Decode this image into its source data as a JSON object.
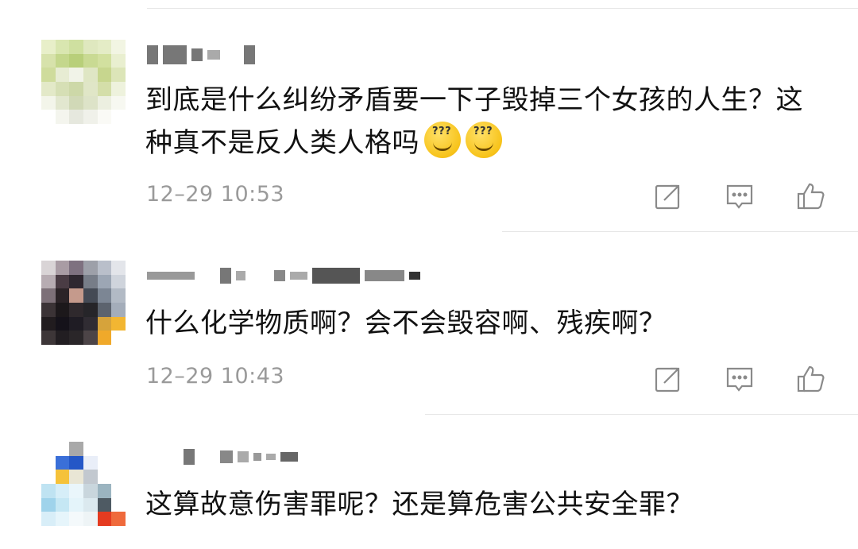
{
  "comments": [
    {
      "text": "到底是什么纠纷矛盾要一下子毁掉三个女孩的人生？这种真不是反人类人格吗",
      "emoji_icon": "dizzy-smile-emoji",
      "time": "12–29 10:53"
    },
    {
      "text": "什么化学物质啊？会不会毁容啊、残疾啊？",
      "time": "12–29 10:43"
    },
    {
      "text": "这算故意伤害罪呢？还是算危害公共安全罪？"
    }
  ],
  "actions": [
    "share-icon",
    "comment-icon",
    "like-icon"
  ]
}
